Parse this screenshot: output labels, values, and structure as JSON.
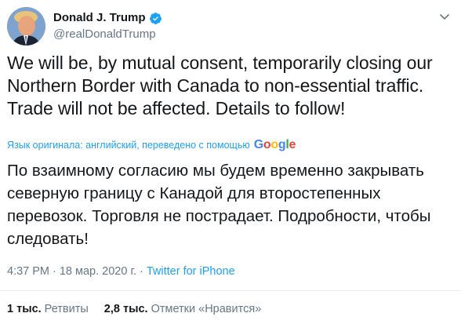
{
  "author": {
    "display_name": "Donald J. Trump",
    "handle": "@realDonaldTrump",
    "verified": true,
    "verified_color": "#1da1f2"
  },
  "tweet": {
    "text": "We will be, by mutual consent, temporarily closing our Northern Border with Canada to non-essential traffic. Trade will not be affected. Details to follow!"
  },
  "translation": {
    "note": "Язык оригинала: английский, переведено с помощью",
    "provider": "Google",
    "text": "По взаимному согласию мы будем временно закрывать северную границу с Канадой для второстепенных перевозок. Торговля не пострадает. Подробности, чтобы следовать!"
  },
  "meta": {
    "time": "4:37 PM",
    "separator": "·",
    "date": "18 мар. 2020 г.",
    "separator2": "·",
    "source": "Twitter for iPhone"
  },
  "stats": {
    "retweets_count": "1 тыс.",
    "retweets_label": "Ретвиты",
    "likes_count": "2,8 тыс.",
    "likes_label": "Отметки «Нравится»"
  },
  "colors": {
    "link": "#1da1f2",
    "secondary_text": "#657786",
    "primary_text": "#14171a",
    "divider": "#e6ecf0"
  },
  "icons": {
    "verified": "verified-badge-icon",
    "menu": "chevron-down-icon"
  }
}
